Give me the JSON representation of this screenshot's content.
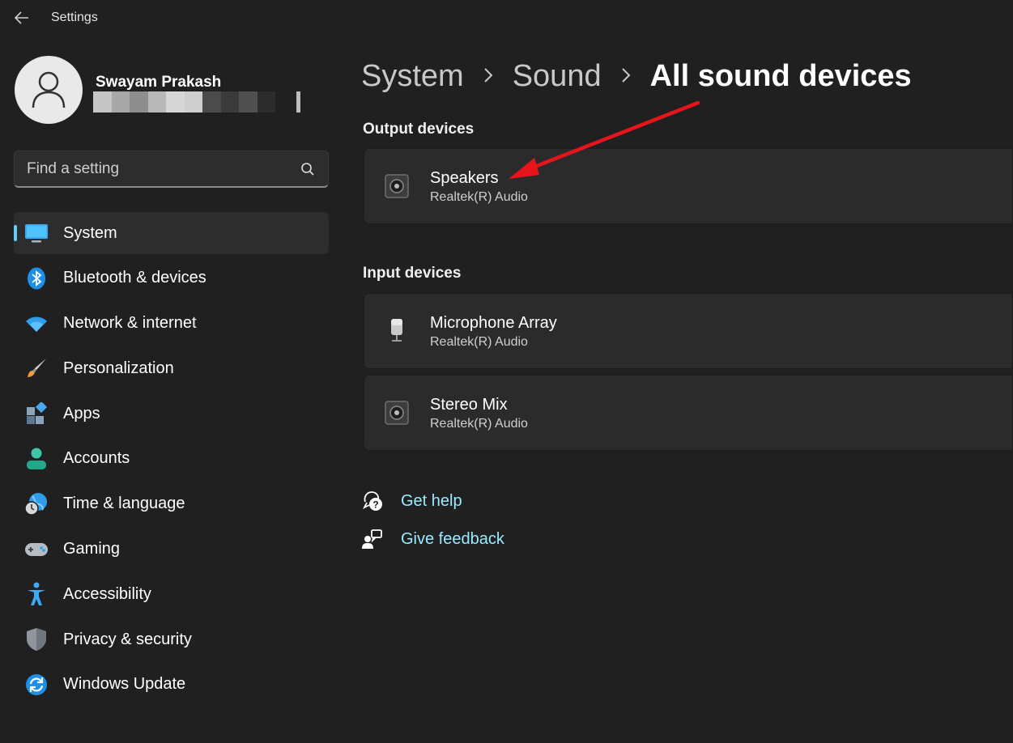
{
  "window": {
    "title": "Settings"
  },
  "profile": {
    "name": "Swayam Prakash",
    "email": ""
  },
  "search": {
    "placeholder": "Find a setting"
  },
  "sidebar": {
    "items": [
      {
        "label": "System",
        "icon": "monitor-icon",
        "active": true
      },
      {
        "label": "Bluetooth & devices",
        "icon": "bluetooth-icon"
      },
      {
        "label": "Network & internet",
        "icon": "wifi-icon"
      },
      {
        "label": "Personalization",
        "icon": "paintbrush-icon"
      },
      {
        "label": "Apps",
        "icon": "apps-icon"
      },
      {
        "label": "Accounts",
        "icon": "person-icon"
      },
      {
        "label": "Time & language",
        "icon": "globe-clock-icon"
      },
      {
        "label": "Gaming",
        "icon": "gamepad-icon"
      },
      {
        "label": "Accessibility",
        "icon": "accessibility-icon"
      },
      {
        "label": "Privacy & security",
        "icon": "shield-icon"
      },
      {
        "label": "Windows Update",
        "icon": "update-icon"
      }
    ]
  },
  "breadcrumb": {
    "level1": "System",
    "level2": "Sound",
    "current": "All sound devices"
  },
  "output": {
    "heading": "Output devices",
    "devices": [
      {
        "name": "Speakers",
        "driver": "Realtek(R) Audio",
        "icon": "speaker-icon"
      }
    ]
  },
  "input": {
    "heading": "Input devices",
    "devices": [
      {
        "name": "Microphone Array",
        "driver": "Realtek(R) Audio",
        "icon": "microphone-icon"
      },
      {
        "name": "Stereo Mix",
        "driver": "Realtek(R) Audio",
        "icon": "speaker-icon"
      }
    ]
  },
  "help": {
    "get_help": "Get help",
    "give_feedback": "Give feedback"
  },
  "colors": {
    "accent": "#60cdff",
    "link": "#99ebff",
    "annotation": "#e8141b",
    "background": "#202020"
  }
}
